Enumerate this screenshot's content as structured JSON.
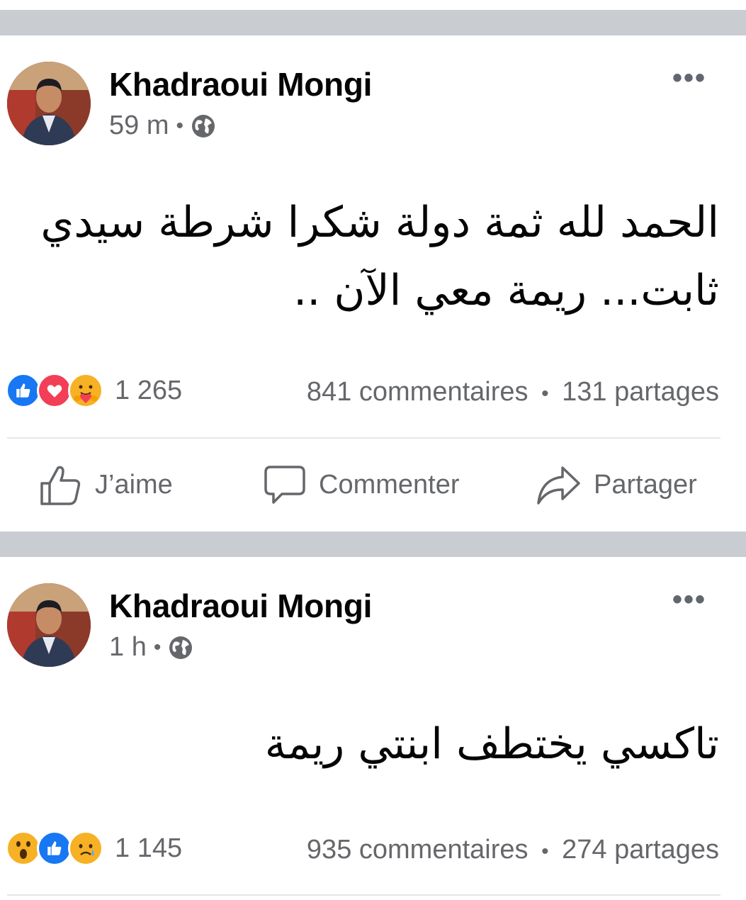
{
  "colors": {
    "separator": "#c9ccd1",
    "like_blue": "#1877f2",
    "love_red": "#f33e58",
    "secondary_text": "#65676b"
  },
  "posts": [
    {
      "author": "Khadraoui Mongi",
      "time": "59 m",
      "meta_sep": "•",
      "audience_icon": "globe-icon",
      "more_label": "•••",
      "text_line1": "الحمد لله ثمة دولة شكرا شرطة سيدي",
      "text_line2": "ثابت... ريمة معي الآن ..",
      "reaction_icons": [
        "like-icon",
        "love-icon",
        "care-icon"
      ],
      "reaction_count": "1 265",
      "comments": "841 commentaires",
      "stats_sep": "•",
      "shares": "131 partages"
    },
    {
      "author": "Khadraoui Mongi",
      "time": "1 h",
      "meta_sep": "•",
      "audience_icon": "globe-icon",
      "more_label": "•••",
      "text_line1": "تاكسي يختطف ابنتي ريمة",
      "reaction_icons": [
        "wow-icon",
        "like-icon",
        "sad-icon"
      ],
      "reaction_count": "1 145",
      "comments": "935 commentaires",
      "stats_sep": "•",
      "shares": "274 partages"
    }
  ],
  "actions": {
    "like": "J’aime",
    "comment": "Commenter",
    "share": "Partager"
  }
}
